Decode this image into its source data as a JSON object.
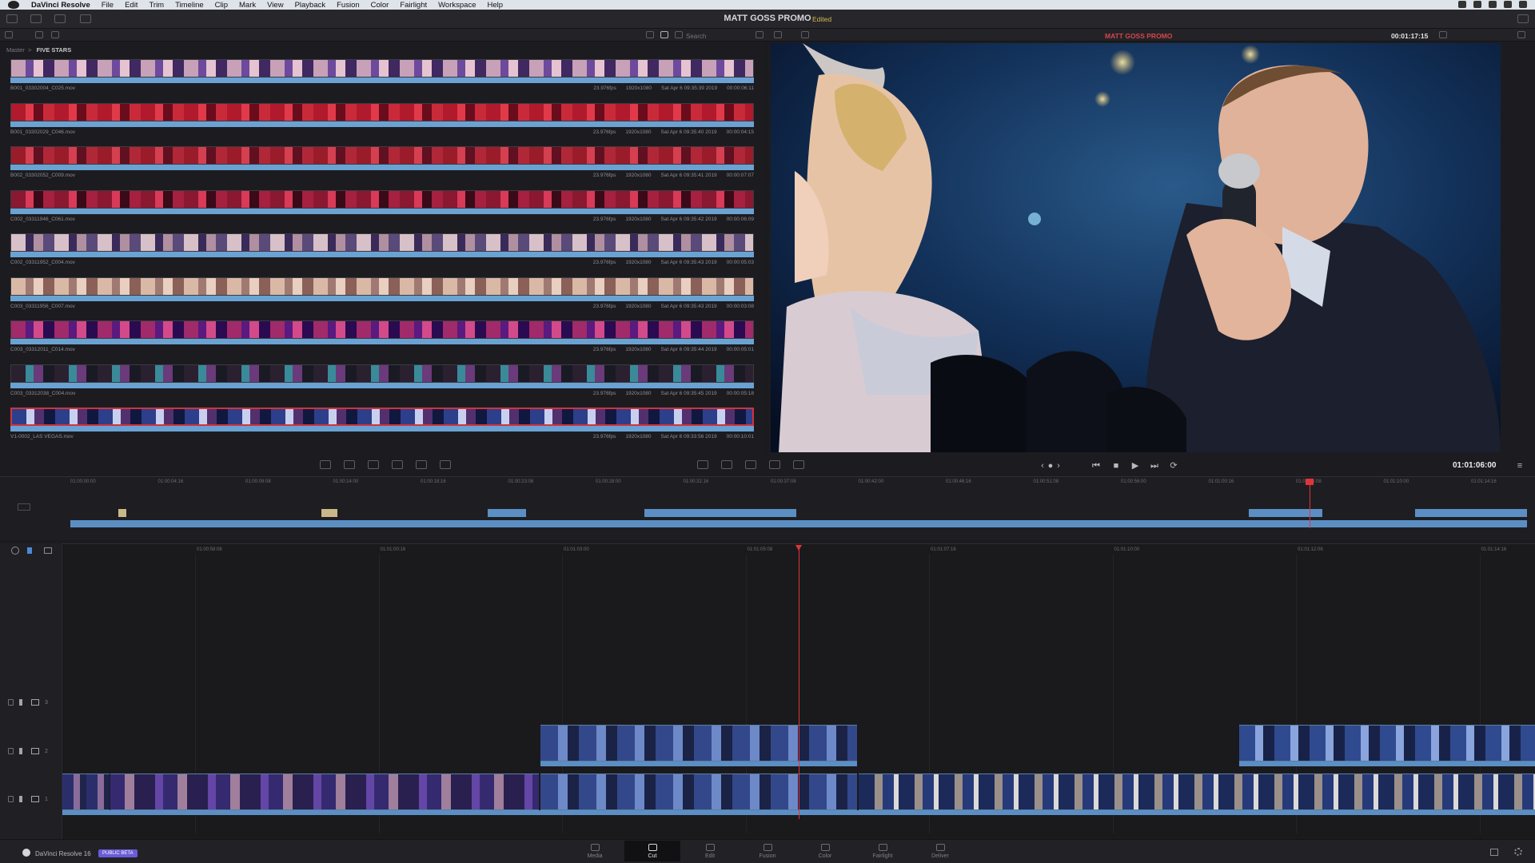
{
  "menubar": {
    "app": "DaVinci Resolve",
    "items": [
      "File",
      "Edit",
      "Trim",
      "Timeline",
      "Clip",
      "Mark",
      "View",
      "Playback",
      "Fusion",
      "Color",
      "Fairlight",
      "Workspace",
      "Help"
    ]
  },
  "title": {
    "project": "MATT GOSS PROMO",
    "status": "Edited"
  },
  "breadcrumb": {
    "root": "Master",
    "current": "FIVE STARS"
  },
  "search": {
    "placeholder": "Search"
  },
  "clips": [
    {
      "name": "B001_03302004_C025.mov",
      "fps": "23.976fps",
      "res": "1920x1080",
      "date": "Sat Apr 6 09:35:39 2019",
      "dur": "00:00:06:11"
    },
    {
      "name": "B001_03302029_C046.mov",
      "fps": "23.976fps",
      "res": "1920x1080",
      "date": "Sat Apr 6 09:35:40 2019",
      "dur": "00:00:04:15"
    },
    {
      "name": "B002_03302052_C009.mov",
      "fps": "23.976fps",
      "res": "1920x1080",
      "date": "Sat Apr 6 09:35:41 2019",
      "dur": "00:00:07:07"
    },
    {
      "name": "C002_03311946_C061.mov",
      "fps": "23.976fps",
      "res": "1920x1080",
      "date": "Sat Apr 6 09:35:42 2019",
      "dur": "00:00:06:09"
    },
    {
      "name": "C002_03311952_C004.mov",
      "fps": "23.976fps",
      "res": "1920x1080",
      "date": "Sat Apr 6 09:35:43 2019",
      "dur": "00:00:05:03"
    },
    {
      "name": "C003_03311956_C007.mov",
      "fps": "23.976fps",
      "res": "1920x1080",
      "date": "Sat Apr 6 09:35:43 2019",
      "dur": "00:00:03:08"
    },
    {
      "name": "C003_03312011_C014.mov",
      "fps": "23.976fps",
      "res": "1920x1080",
      "date": "Sat Apr 6 09:35:44 2019",
      "dur": "00:00:05:01"
    },
    {
      "name": "C003_03312038_C004.mov",
      "fps": "23.976fps",
      "res": "1920x1080",
      "date": "Sat Apr 6 09:35:45 2019",
      "dur": "00:00:05:18"
    },
    {
      "name": "V1-0002_LAS VEGAS.mov",
      "fps": "23.976fps",
      "res": "1920x1080",
      "date": "Sat Apr 6 09:33:56 2019",
      "dur": "00:00:10:01"
    }
  ],
  "viewer": {
    "clip_name": "MATT GOSS PROMO",
    "timecode": "00:01:17:15"
  },
  "transport": {
    "timecode": "01:01:06:00"
  },
  "upper_ruler": [
    "01:00:00:00",
    "01:00:04:16",
    "01:00:09:08",
    "01:00:14:00",
    "01:00:18:16",
    "01:00:23:08",
    "01:00:28:00",
    "01:00:32:16",
    "01:00:37:08",
    "01:00:42:00",
    "01:00:46:16",
    "01:00:51:08",
    "01:00:56:00",
    "01:01:00:16",
    "01:01:05:08",
    "01:01:10:00",
    "01:01:14:16"
  ],
  "lower_ruler": [
    "01:00:58:08",
    "01:01:00:16",
    "01:01:03:00",
    "01:01:05:08",
    "01:01:07:16",
    "01:01:10:00",
    "01:01:12:08",
    "01:01:14:16"
  ],
  "tracks": [
    "3",
    "2",
    "1"
  ],
  "bottom": {
    "app_name": "DaVinci Resolve 16",
    "badge": "PUBLIC BETA",
    "pages": [
      "Media",
      "Cut",
      "Edit",
      "Fusion",
      "Color",
      "Fairlight",
      "Deliver"
    ],
    "active_page": "Cut"
  },
  "colors": {
    "accent_blue": "#6aa2d3",
    "playhead_red": "#e0343a",
    "edited_yellow": "#d2b94e",
    "beta_purple": "#6a5bd8"
  },
  "icons": [
    "apple-icon",
    "wifi-icon",
    "spotlight-icon",
    "grid-view-icon",
    "strip-view-icon",
    "sort-icon",
    "lock-icon",
    "speaker-icon",
    "monitor-icon",
    "play-icon",
    "stop-icon",
    "skip-back-icon",
    "skip-forward-icon",
    "loop-icon",
    "resolve-logo-icon",
    "home-icon",
    "gear-icon"
  ]
}
